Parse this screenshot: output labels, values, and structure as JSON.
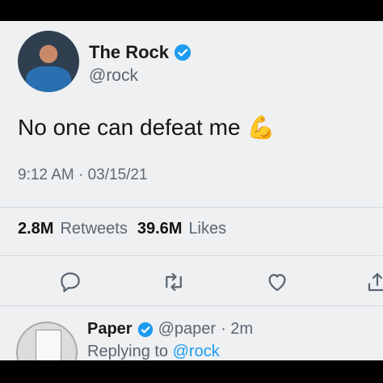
{
  "tweet": {
    "display_name": "The Rock",
    "handle": "@rock",
    "text": "No one can defeat me",
    "emoji": "💪",
    "timestamp": "9:12 AM · 03/15/21"
  },
  "stats": {
    "retweets_count": "2.8M",
    "retweets_label": "Retweets",
    "likes_count": "39.6M",
    "likes_label": "Likes"
  },
  "actions": {
    "reply_icon": "reply-icon",
    "retweet_icon": "retweet-icon",
    "like_icon": "heart-icon",
    "share_icon": "share-icon"
  },
  "reply": {
    "display_name": "Paper",
    "handle": "@paper",
    "time": "· 2m",
    "replying_prefix": "Replying to",
    "replying_to": "@rock"
  },
  "colors": {
    "verified": "#1d9bf0",
    "background": "#eef0f2",
    "icon": "#5b6670"
  }
}
